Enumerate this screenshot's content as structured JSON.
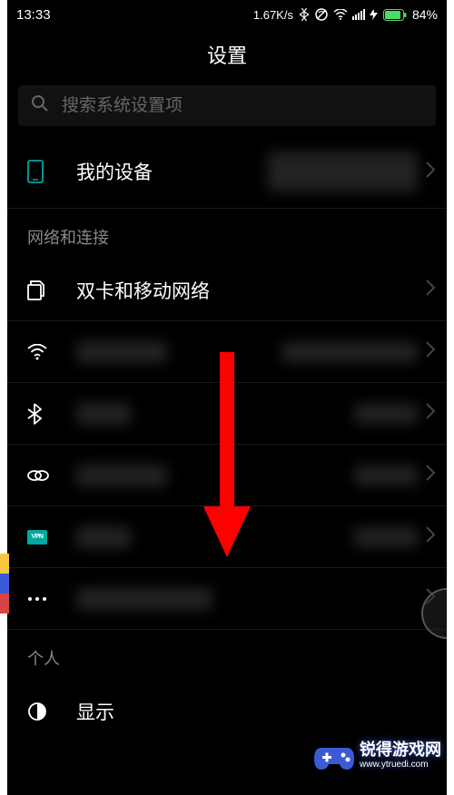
{
  "status_bar": {
    "time": "13:33",
    "speed": "1.67K/s",
    "battery_pct": "84%"
  },
  "page": {
    "title": "设置"
  },
  "search": {
    "placeholder": "搜索系统设置项"
  },
  "sections": {
    "network_header": "网络和连接",
    "personal_header": "个人"
  },
  "items": {
    "my_device": {
      "label": "我的设备",
      "icon": "phone-icon"
    },
    "sim_network": {
      "label": "双卡和移动网络",
      "icon": "sim-icon"
    },
    "display": {
      "label": "显示",
      "icon": "brightness-icon"
    },
    "wifi_icon": "wifi-icon",
    "bluetooth_icon": "bluetooth-icon",
    "link_icon": "link-icon",
    "vpn_icon": "vpn-icon",
    "more_icon": "dots-icon",
    "vpn_badge_text": "VPN"
  },
  "watermark": {
    "title": "锐得游戏网",
    "url": "www.ytruedi.com"
  }
}
